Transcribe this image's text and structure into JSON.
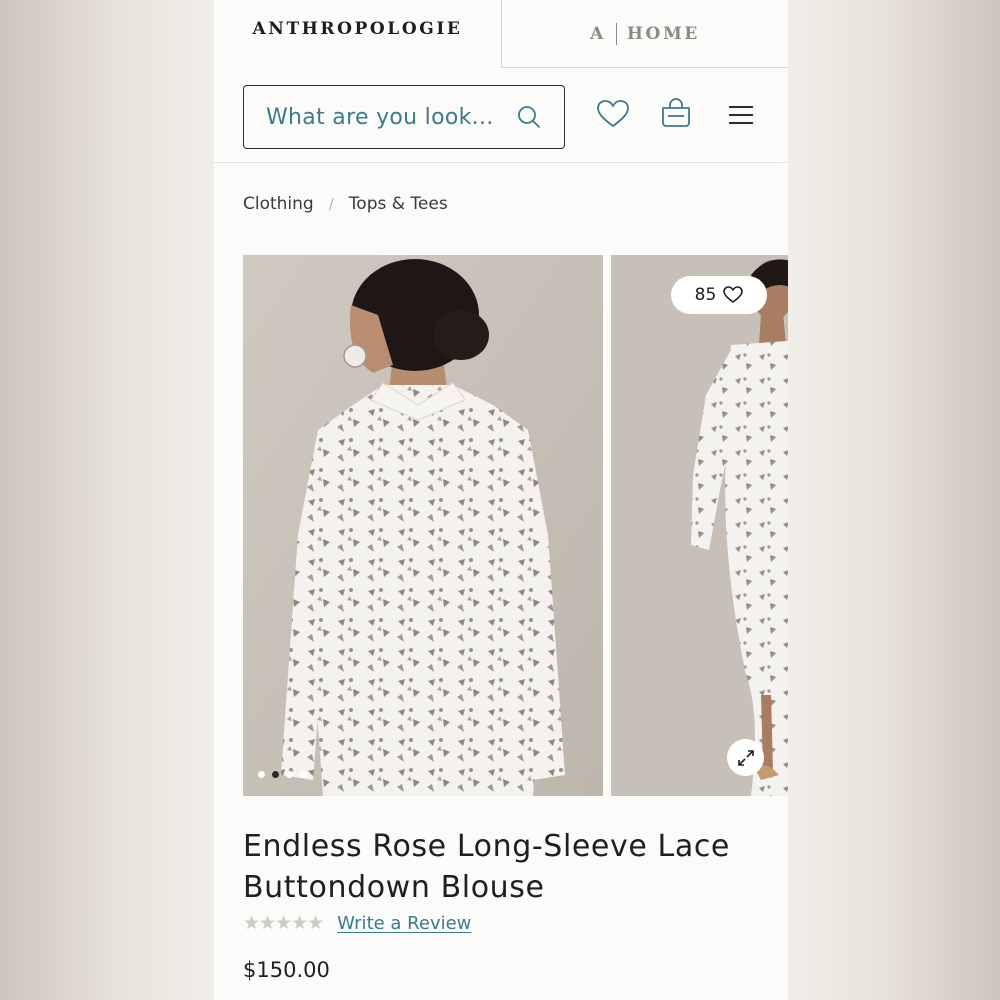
{
  "tabs": {
    "anthropologie": "ANTHROPOLOGIE",
    "home_letter": "A",
    "home_label": "HOME"
  },
  "header": {
    "search_placeholder": "What are you look...",
    "icons": [
      "search-icon",
      "heart-icon",
      "bag-icon",
      "menu-icon"
    ]
  },
  "breadcrumbs": {
    "items": [
      "Clothing",
      "Tops & Tees"
    ],
    "separator": "/"
  },
  "gallery": {
    "likes_count": "85",
    "slide_count": 4,
    "active_slide": 2
  },
  "product": {
    "title": "Endless Rose Long-Sleeve Lace Buttondown Blouse",
    "rating_stars": "★★★★★",
    "review_link": "Write a Review",
    "price": "$150.00"
  },
  "colors": {
    "accent": "#3c7a8e",
    "text": "#1f1f1f",
    "page_bg": "#fbfbf9"
  }
}
